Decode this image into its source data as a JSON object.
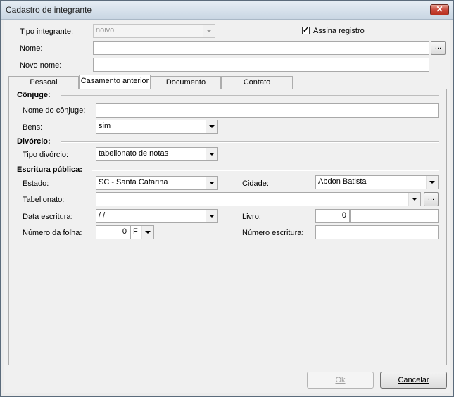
{
  "window": {
    "title": "Cadastro de integrante"
  },
  "header": {
    "tipo_label": "Tipo integrante:",
    "tipo_value": "noivo",
    "assina_label": "Assina registro",
    "assina_checked": true,
    "nome_label": "Nome:",
    "nome_value": "",
    "nome_btn": "...",
    "novo_nome_label": "Novo nome:",
    "novo_nome_value": ""
  },
  "tabs": [
    {
      "label": "Pessoal",
      "active": false
    },
    {
      "label": "Casamento anterior",
      "active": true
    },
    {
      "label": "Documento",
      "active": false
    },
    {
      "label": "Contato",
      "active": false
    }
  ],
  "conjuge": {
    "section": "Cônjuge:",
    "nome_label": "Nome do cônjuge:",
    "nome_value": "",
    "bens_label": "Bens:",
    "bens_value": "sim"
  },
  "divorcio": {
    "section": "Divórcio:",
    "tipo_label": "Tipo divórcio:",
    "tipo_value": "tabelionato de notas"
  },
  "escritura": {
    "section": "Escritura pública:",
    "estado_label": "Estado:",
    "estado_value": "SC - Santa Catarina",
    "cidade_label": "Cidade:",
    "cidade_value": "Abdon Batista",
    "tabelionato_label": "Tabelionato:",
    "tabelionato_value": "",
    "tabelionato_btn": "...",
    "data_label": "Data escritura:",
    "data_value": " /  /",
    "livro_label": "Livro:",
    "livro_num": "0",
    "livro_suffix": "",
    "folha_label": "Número da folha:",
    "folha_num": "0",
    "folha_side": "F",
    "numero_label": "Número escritura:",
    "numero_value": ""
  },
  "footer": {
    "ok_label": "Ok",
    "cancel_label": "Cancelar"
  }
}
